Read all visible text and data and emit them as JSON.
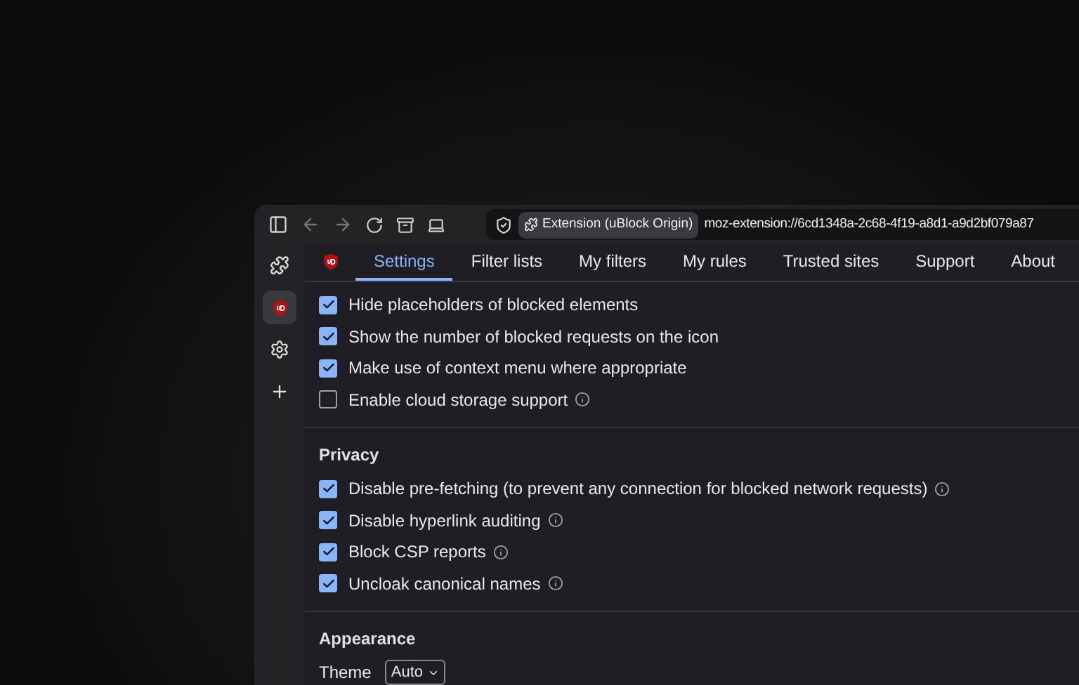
{
  "toolbar": {
    "site_label": "Extension (uBlock Origin)",
    "url": "moz-extension://6cd1348a-2c68-4f19-a8d1-a9d2bf079a87"
  },
  "sidebar": {
    "items": [
      {
        "kind": "extensions",
        "selected": false
      },
      {
        "kind": "ublock",
        "selected": true
      },
      {
        "kind": "settings",
        "selected": false
      },
      {
        "kind": "add",
        "selected": false
      }
    ]
  },
  "tabs": [
    {
      "label": "Settings",
      "selected": true
    },
    {
      "label": "Filter lists",
      "selected": false
    },
    {
      "label": "My filters",
      "selected": false
    },
    {
      "label": "My rules",
      "selected": false
    },
    {
      "label": "Trusted sites",
      "selected": false
    },
    {
      "label": "Support",
      "selected": false
    },
    {
      "label": "About",
      "selected": false
    }
  ],
  "sections": [
    {
      "options": [
        {
          "label": "Hide placeholders of blocked elements",
          "checked": true,
          "info": false
        },
        {
          "label": "Show the number of blocked requests on the icon",
          "checked": true,
          "info": false
        },
        {
          "label": "Make use of context menu where appropriate",
          "checked": true,
          "info": false
        },
        {
          "label": "Enable cloud storage support",
          "checked": false,
          "info": true
        }
      ]
    },
    {
      "title": "Privacy",
      "options": [
        {
          "label": "Disable pre-fetching (to prevent any connection for blocked network requests)",
          "checked": true,
          "info": true
        },
        {
          "label": "Disable hyperlink auditing",
          "checked": true,
          "info": true
        },
        {
          "label": "Block CSP reports",
          "checked": true,
          "info": true
        },
        {
          "label": "Uncloak canonical names",
          "checked": true,
          "info": true
        }
      ]
    },
    {
      "title": "Appearance",
      "theme": {
        "label": "Theme",
        "value": "Auto"
      }
    }
  ]
}
